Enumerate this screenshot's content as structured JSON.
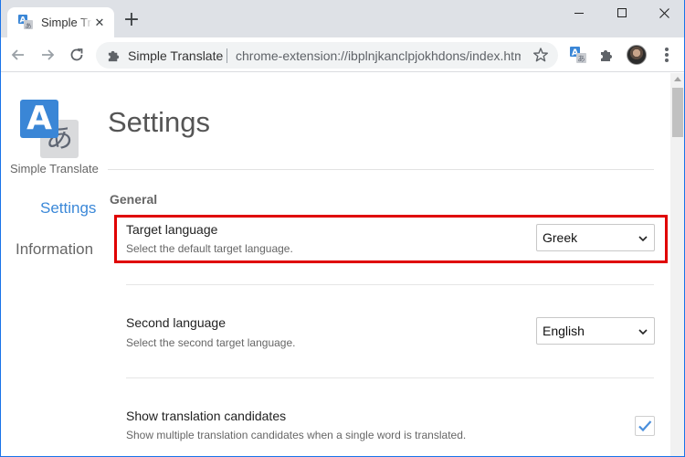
{
  "browser": {
    "tab": {
      "title": "Simple Translate",
      "favicon": "translate-icon",
      "close_icon": "close-icon"
    },
    "new_tab_icon": "plus-icon",
    "window_controls": [
      "minimize-icon",
      "maximize-icon",
      "close-icon"
    ],
    "omnibox": {
      "extension_name": "Simple Translate",
      "url": "chrome-extension://ibplnjkanclpjokhdons/index.html",
      "extension_icon": "puzzle-icon",
      "star_icon": "star-icon"
    },
    "toolbar_icons": [
      "back-icon",
      "forward-icon",
      "reload-icon",
      "translate-icon",
      "puzzle-icon",
      "avatar",
      "menu-icon"
    ]
  },
  "sidebar": {
    "app_name": "Simple Translate",
    "logo": {
      "latin_glyph": "A",
      "japanese_glyph": "あ"
    },
    "items": [
      {
        "label": "Settings",
        "active": true
      },
      {
        "label": "Information",
        "active": false
      }
    ]
  },
  "main": {
    "title": "Settings",
    "section": "General",
    "settings": [
      {
        "label": "Target language",
        "description": "Select the default target language.",
        "control": "select",
        "value": "Greek",
        "highlighted": true
      },
      {
        "label": "Second language",
        "description": "Select the second target language.",
        "control": "select",
        "value": "English",
        "highlighted": false
      },
      {
        "label": "Show translation candidates",
        "description": "Show multiple translation candidates when a single word is translated.",
        "control": "checkbox",
        "checked": true,
        "highlighted": false
      }
    ]
  },
  "colors": {
    "accent": "#3b88d8",
    "highlight_border": "#e00000",
    "tabstrip": "#dee1e6",
    "omnibox": "#f1f3f4",
    "checkmark": "#4a8fdc"
  }
}
